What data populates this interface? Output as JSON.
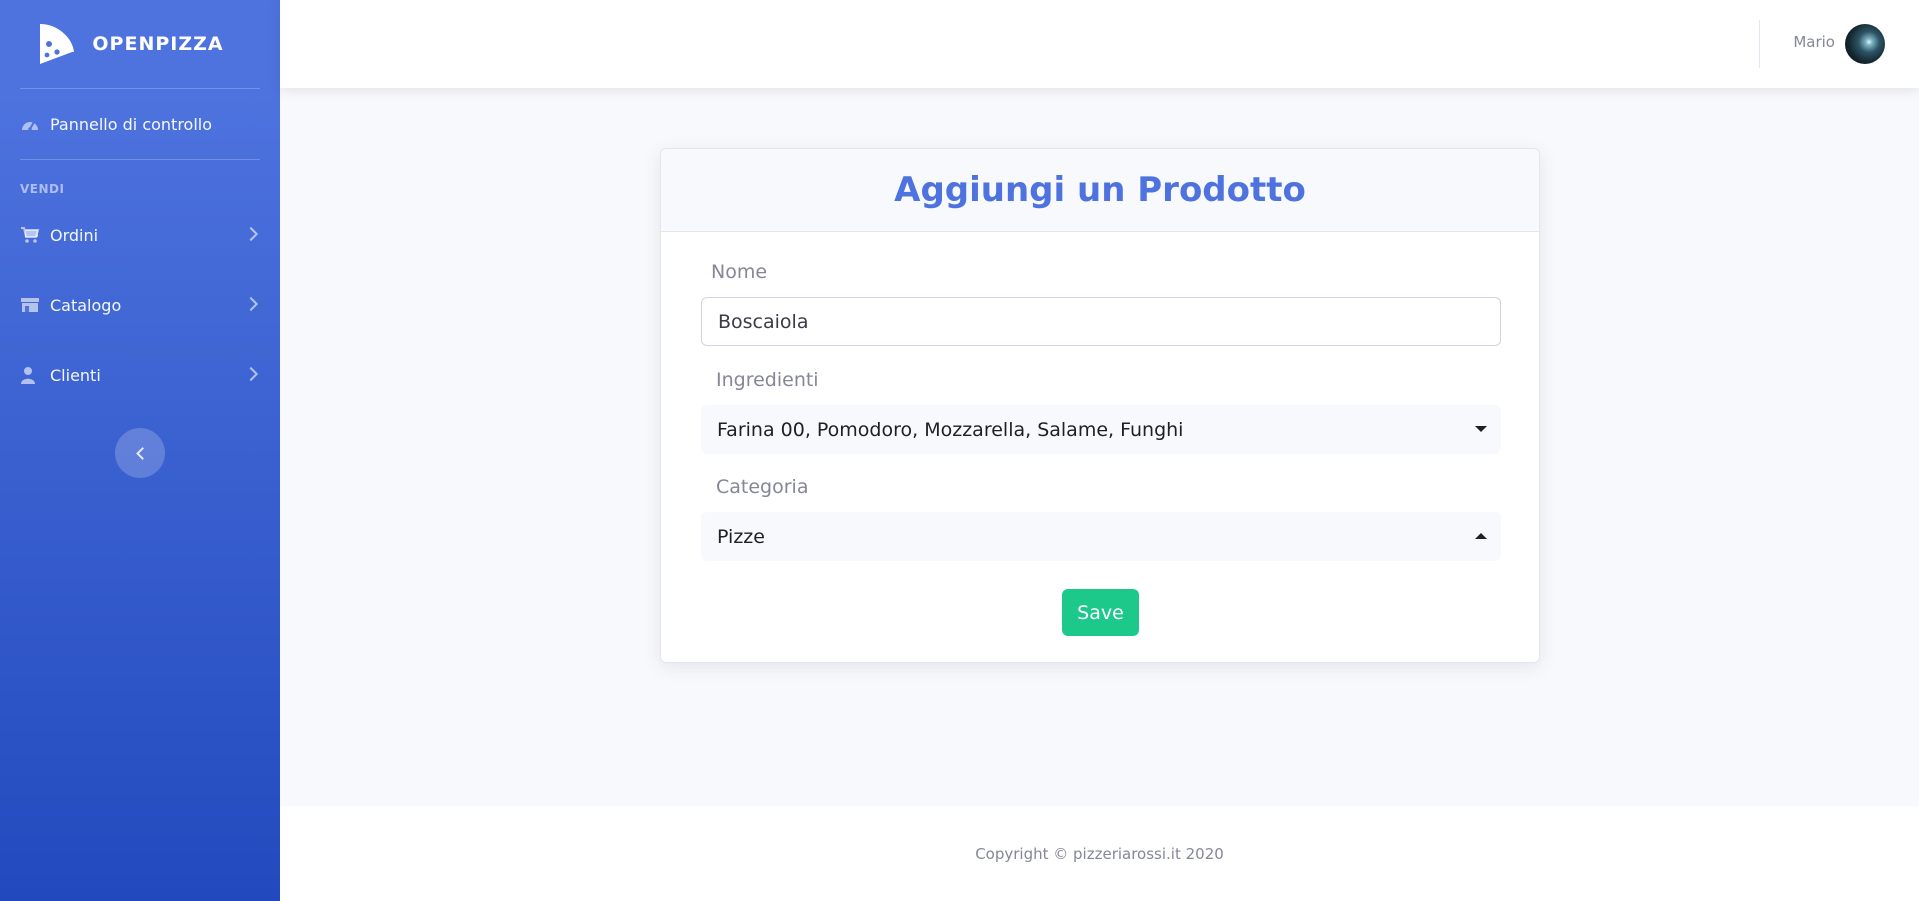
{
  "sidebar": {
    "brand": "OPENPIZZA",
    "dashboard": "Pannello di controllo",
    "heading": "VENDI",
    "items": [
      {
        "label": "Ordini",
        "icon": "cart-icon"
      },
      {
        "label": "Catalogo",
        "icon": "store-icon"
      },
      {
        "label": "Clienti",
        "icon": "user-icon"
      }
    ]
  },
  "topbar": {
    "user_name": "Mario"
  },
  "form": {
    "title": "Aggiungi un Prodotto",
    "name_label": "Nome",
    "name_value": "Boscaiola",
    "ingredients_label": "Ingredienti",
    "ingredients_value": "Farina 00, Pomodoro, Mozzarella, Salame, Funghi",
    "category_label": "Categoria",
    "category_value": "Pizze",
    "save_label": "Save"
  },
  "footer": {
    "copyright": "Copyright © pizzeriarossi.it 2020"
  },
  "colors": {
    "primary": "#4e73df",
    "success": "#1cc88a",
    "sidebar_bottom": "#224abe",
    "background": "#f8f9fc"
  }
}
